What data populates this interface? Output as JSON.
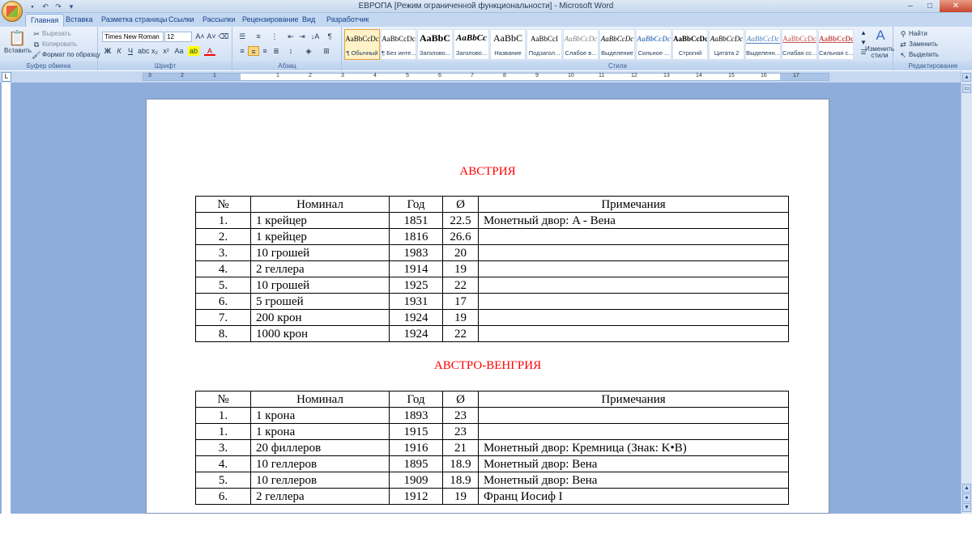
{
  "window": {
    "title": "ЕВРОПА [Режим ограниченной функциональности] - Microsoft Word"
  },
  "tabs": [
    "Главная",
    "Вставка",
    "Разметка страницы",
    "Ссылки",
    "Рассылки",
    "Рецензирование",
    "Вид",
    "Разработчик"
  ],
  "ribbon": {
    "clipboard": {
      "label": "Буфер обмена",
      "paste": "Вставить",
      "cut": "Вырезать",
      "copy": "Копировать",
      "format_painter": "Формат по образцу"
    },
    "font": {
      "label": "Шрифт",
      "font_name": "Times New Roman",
      "font_size": "12",
      "bold": "Ж",
      "italic": "К",
      "underline": "Ч"
    },
    "paragraph": {
      "label": "Абзац"
    },
    "styles": {
      "label": "Стили",
      "items": [
        {
          "sample": "AaBbCcDc",
          "name": "¶ Обычный"
        },
        {
          "sample": "AaBbCcDc",
          "name": "¶ Без инте..."
        },
        {
          "sample": "AaBbC",
          "name": "Заголово..."
        },
        {
          "sample": "AaBbCc",
          "name": "Заголово..."
        },
        {
          "sample": "AaBbC",
          "name": "Название"
        },
        {
          "sample": "AaBbCcI",
          "name": "Подзагол..."
        },
        {
          "sample": "AaBbCcDc",
          "name": "Слабое в..."
        },
        {
          "sample": "AaBbCcDc",
          "name": "Выделение"
        },
        {
          "sample": "AaBbCcDc",
          "name": "Сильное ..."
        },
        {
          "sample": "AaBbCcDc",
          "name": "Строгий"
        },
        {
          "sample": "AaBbCcDc",
          "name": "Цитата 2"
        },
        {
          "sample": "AaBbCcDc",
          "name": "Выделенн..."
        },
        {
          "sample": "AaBbCcDc",
          "name": "Слабая сс..."
        },
        {
          "sample": "AaBbCcDc",
          "name": "Сильная с..."
        }
      ],
      "change_styles": "Изменить стили"
    },
    "editing": {
      "label": "Редактирование",
      "find": "Найти",
      "replace": "Заменить",
      "select": "Выделить"
    }
  },
  "ruler": {
    "numbers": [
      "3",
      "2",
      "1",
      "1",
      "2",
      "3",
      "4",
      "5",
      "6",
      "7",
      "8",
      "9",
      "10",
      "11",
      "12",
      "13",
      "14",
      "15",
      "16",
      "17"
    ]
  },
  "document": {
    "section1": {
      "title": "АВСТРИЯ",
      "headers": [
        "№",
        "Номинал",
        "Год",
        "Ø",
        "Примечания"
      ],
      "rows": [
        [
          "1.",
          "1 крейцер",
          "1851",
          "22.5",
          "Монетный двор: A - Вена"
        ],
        [
          "2.",
          "1 крейцер",
          "1816",
          "26.6",
          ""
        ],
        [
          "3.",
          "10 грошей",
          "1983",
          "20",
          ""
        ],
        [
          "4.",
          "2 геллера",
          "1914",
          "19",
          ""
        ],
        [
          "5.",
          "10 грошей",
          "1925",
          "22",
          ""
        ],
        [
          "6.",
          "5 грошей",
          "1931",
          "17",
          ""
        ],
        [
          "7.",
          "200 крон",
          "1924",
          "19",
          ""
        ],
        [
          "8.",
          "1000 крон",
          "1924",
          "22",
          ""
        ]
      ]
    },
    "section2": {
      "title": "АВСТРО-ВЕНГРИЯ",
      "headers": [
        "№",
        "Номинал",
        "Год",
        "Ø",
        "Примечания"
      ],
      "rows": [
        [
          "1.",
          "1 крона",
          "1893",
          "23",
          ""
        ],
        [
          "1.",
          "1 крона",
          "1915",
          "23",
          ""
        ],
        [
          "3.",
          "20 филлеров",
          "1916",
          "21",
          "Монетный двор: Кремница (Знак: K•B)"
        ],
        [
          "4.",
          "10 геллеров",
          "1895",
          "18.9",
          "Монетный двор: Вена"
        ],
        [
          "5.",
          "10 геллеров",
          "1909",
          "18.9",
          "Монетный двор: Вена"
        ],
        [
          "6.",
          "2 геллера",
          "1912",
          "19",
          "Франц Иосиф I"
        ]
      ]
    }
  },
  "colors": {
    "heading_red": "#ff0000",
    "ribbon_blue": "#dbe7f7",
    "workspace_blue": "#8faddb"
  }
}
